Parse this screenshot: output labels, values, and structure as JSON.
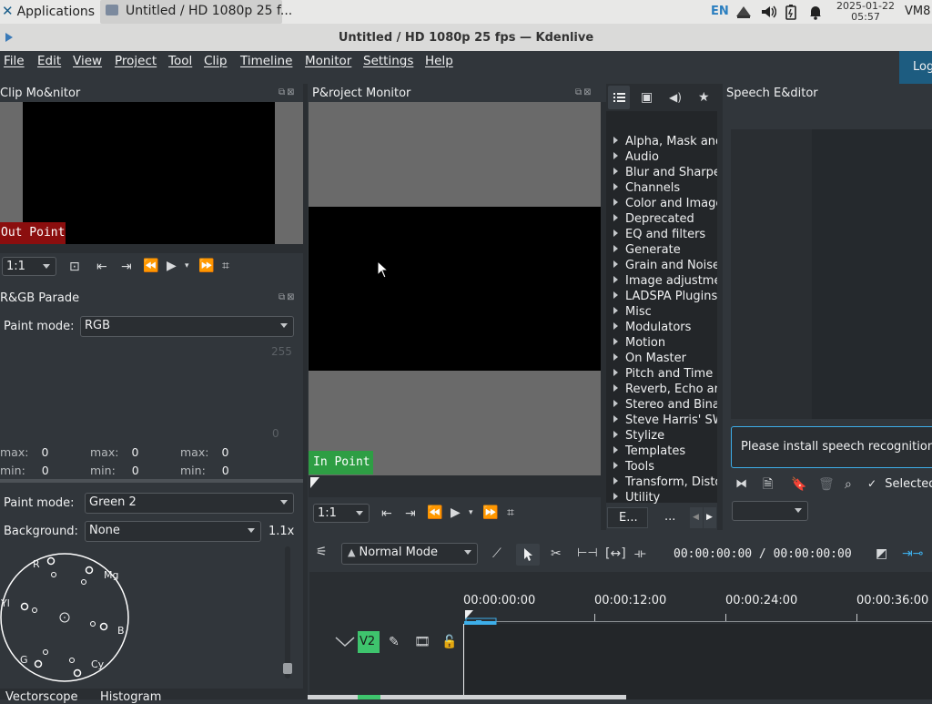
{
  "system_bar": {
    "applications_label": "Applications",
    "task_label": "Untitled / HD 1080p 25 f...",
    "keyboard_layout": "EN",
    "clock_date": "2025-01-22",
    "clock_time": "05:57",
    "vm_label": "VM8"
  },
  "window": {
    "title": "Untitled / HD 1080p 25 fps — Kdenlive"
  },
  "menu": {
    "items": [
      "File",
      "Edit",
      "View",
      "Project",
      "Tool",
      "Clip",
      "Timeline",
      "Monitor",
      "Settings",
      "Help"
    ],
    "log_button": "Log"
  },
  "clip_monitor": {
    "title": "Clip Mo&nitor",
    "out_point_label": "Out Point",
    "zoom": "1:1"
  },
  "rgb_parade": {
    "title": "R&GB Parade",
    "paint_mode_label": "Paint mode:",
    "paint_mode_value": "RGB",
    "scale_top": "255",
    "scale_bottom": "0",
    "stats": [
      {
        "max_label": "max:",
        "max": "0",
        "min_label": "min:",
        "min": "0"
      },
      {
        "max_label": "max:",
        "max": "0",
        "min_label": "min:",
        "min": "0"
      },
      {
        "max_label": "max:",
        "max": "0",
        "min_label": "min:",
        "min": "0"
      }
    ]
  },
  "vectorscope": {
    "paint_mode_label": "Paint mode:",
    "paint_mode_value": "Green 2",
    "background_label": "Background:",
    "background_value": "None",
    "zoom": "1.1x",
    "labels": {
      "r": "R",
      "mg": "Mg",
      "yl": "Yl",
      "b": "B",
      "g": "G",
      "cy": "Cy"
    }
  },
  "bottom_tabs": [
    "Vectorscope",
    "Histogram"
  ],
  "project_monitor": {
    "title": "P&roject Monitor",
    "in_point_label": "In Point",
    "zoom": "1:1"
  },
  "effects": {
    "categories": [
      "Alpha, Mask and Keying",
      "Audio",
      "Blur and Sharpen",
      "Channels",
      "Color and Image correction",
      "Deprecated",
      "EQ and filters",
      "Generate",
      "Grain and Noise",
      "Image adjustment",
      "LADSPA Plugins",
      "Misc",
      "Modulators",
      "Motion",
      "On Master",
      "Pitch and Time",
      "Reverb, Echo and Delay",
      "Stereo and Binaural",
      "Steve Harris' SWH plugins",
      "Stylize",
      "Templates",
      "Tools",
      "Transform, Distort and Perspective",
      "Utility"
    ],
    "tab_effects": "E...",
    "tab_more": "..."
  },
  "speech_editor": {
    "title": "Speech E&ditor",
    "message": "Please install speech recognition",
    "selected_label": "Selected"
  },
  "timeline": {
    "mode": "Normal Mode",
    "timecode": "00:00:00:00 / 00:00:00:00",
    "ruler": [
      "00:00:00:00",
      "00:00:12:00",
      "00:00:24:00",
      "00:00:36:00"
    ],
    "track_label": "V2"
  },
  "colors": {
    "out_point_bg": "#8b0e0e",
    "in_point_bg": "#2e9e44",
    "track_badge": "#3ec46d",
    "accent": "#3daee9",
    "panel_bg": "#31363b",
    "log_button_bg": "#1d5c80"
  }
}
